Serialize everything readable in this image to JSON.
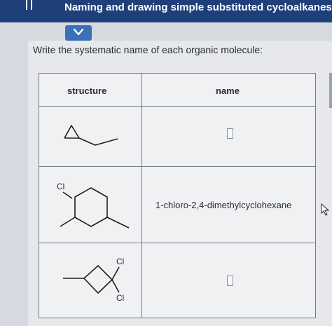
{
  "header": {
    "title": "Naming and drawing simple substituted cycloalkanes"
  },
  "question": {
    "prompt": "Write the systematic name of each organic molecule:"
  },
  "table": {
    "columns": [
      "structure",
      "name"
    ],
    "rows": [
      {
        "name_value": ""
      },
      {
        "name_value": "1-chloro-2,4-dimethylcyclohexane",
        "substituent_label": "Cl"
      },
      {
        "name_value": "",
        "substituent_labels": [
          "Cl",
          "Cl"
        ]
      }
    ]
  },
  "icons": {
    "menu": "menu-icon",
    "collapse": "chevron-down-icon",
    "cursor": "mouse-pointer-icon"
  },
  "colors": {
    "header_bg": "#1f3f7a",
    "accent_button": "#3b6fb6"
  }
}
